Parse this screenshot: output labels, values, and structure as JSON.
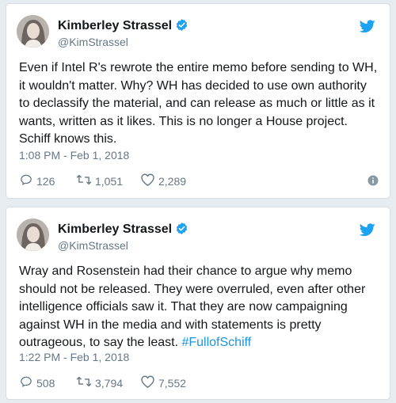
{
  "colors": {
    "background": "#e6ecf0",
    "text": "#14171a",
    "secondary": "#657786",
    "twitter_blue": "#1da1f2",
    "hashtag": "#1b95e0"
  },
  "tweets": [
    {
      "author_name": "Kimberley Strassel",
      "handle": "@KimStrassel",
      "text": "Even if Intel R's rewrote the entire memo before sending to WH, it wouldn't matter. Why? WH has decided to use own authority to declassify the material, and can release as much or little as it wants, written as it likes. This is no longer a House project. Schiff knows this.",
      "hashtag": "",
      "timestamp": "1:08 PM - Feb 1, 2018",
      "replies": "126",
      "retweets": "1,051",
      "likes": "2,289"
    },
    {
      "author_name": "Kimberley Strassel",
      "handle": "@KimStrassel",
      "text": "Wray and Rosenstein had their chance to argue why memo should not be released. They were overruled, even after other intelligence officials saw it. That they are now campaigning against WH in the media and with statements is pretty outrageous, to say the least.",
      "hashtag": "#FullofSchiff",
      "timestamp": "1:22 PM - Feb 1, 2018",
      "replies": "508",
      "retweets": "3,794",
      "likes": "7,552"
    }
  ],
  "icons": [
    "avatar",
    "verified-badge-icon",
    "twitter-bird-icon",
    "reply-icon",
    "retweet-icon",
    "like-icon",
    "info-icon"
  ]
}
